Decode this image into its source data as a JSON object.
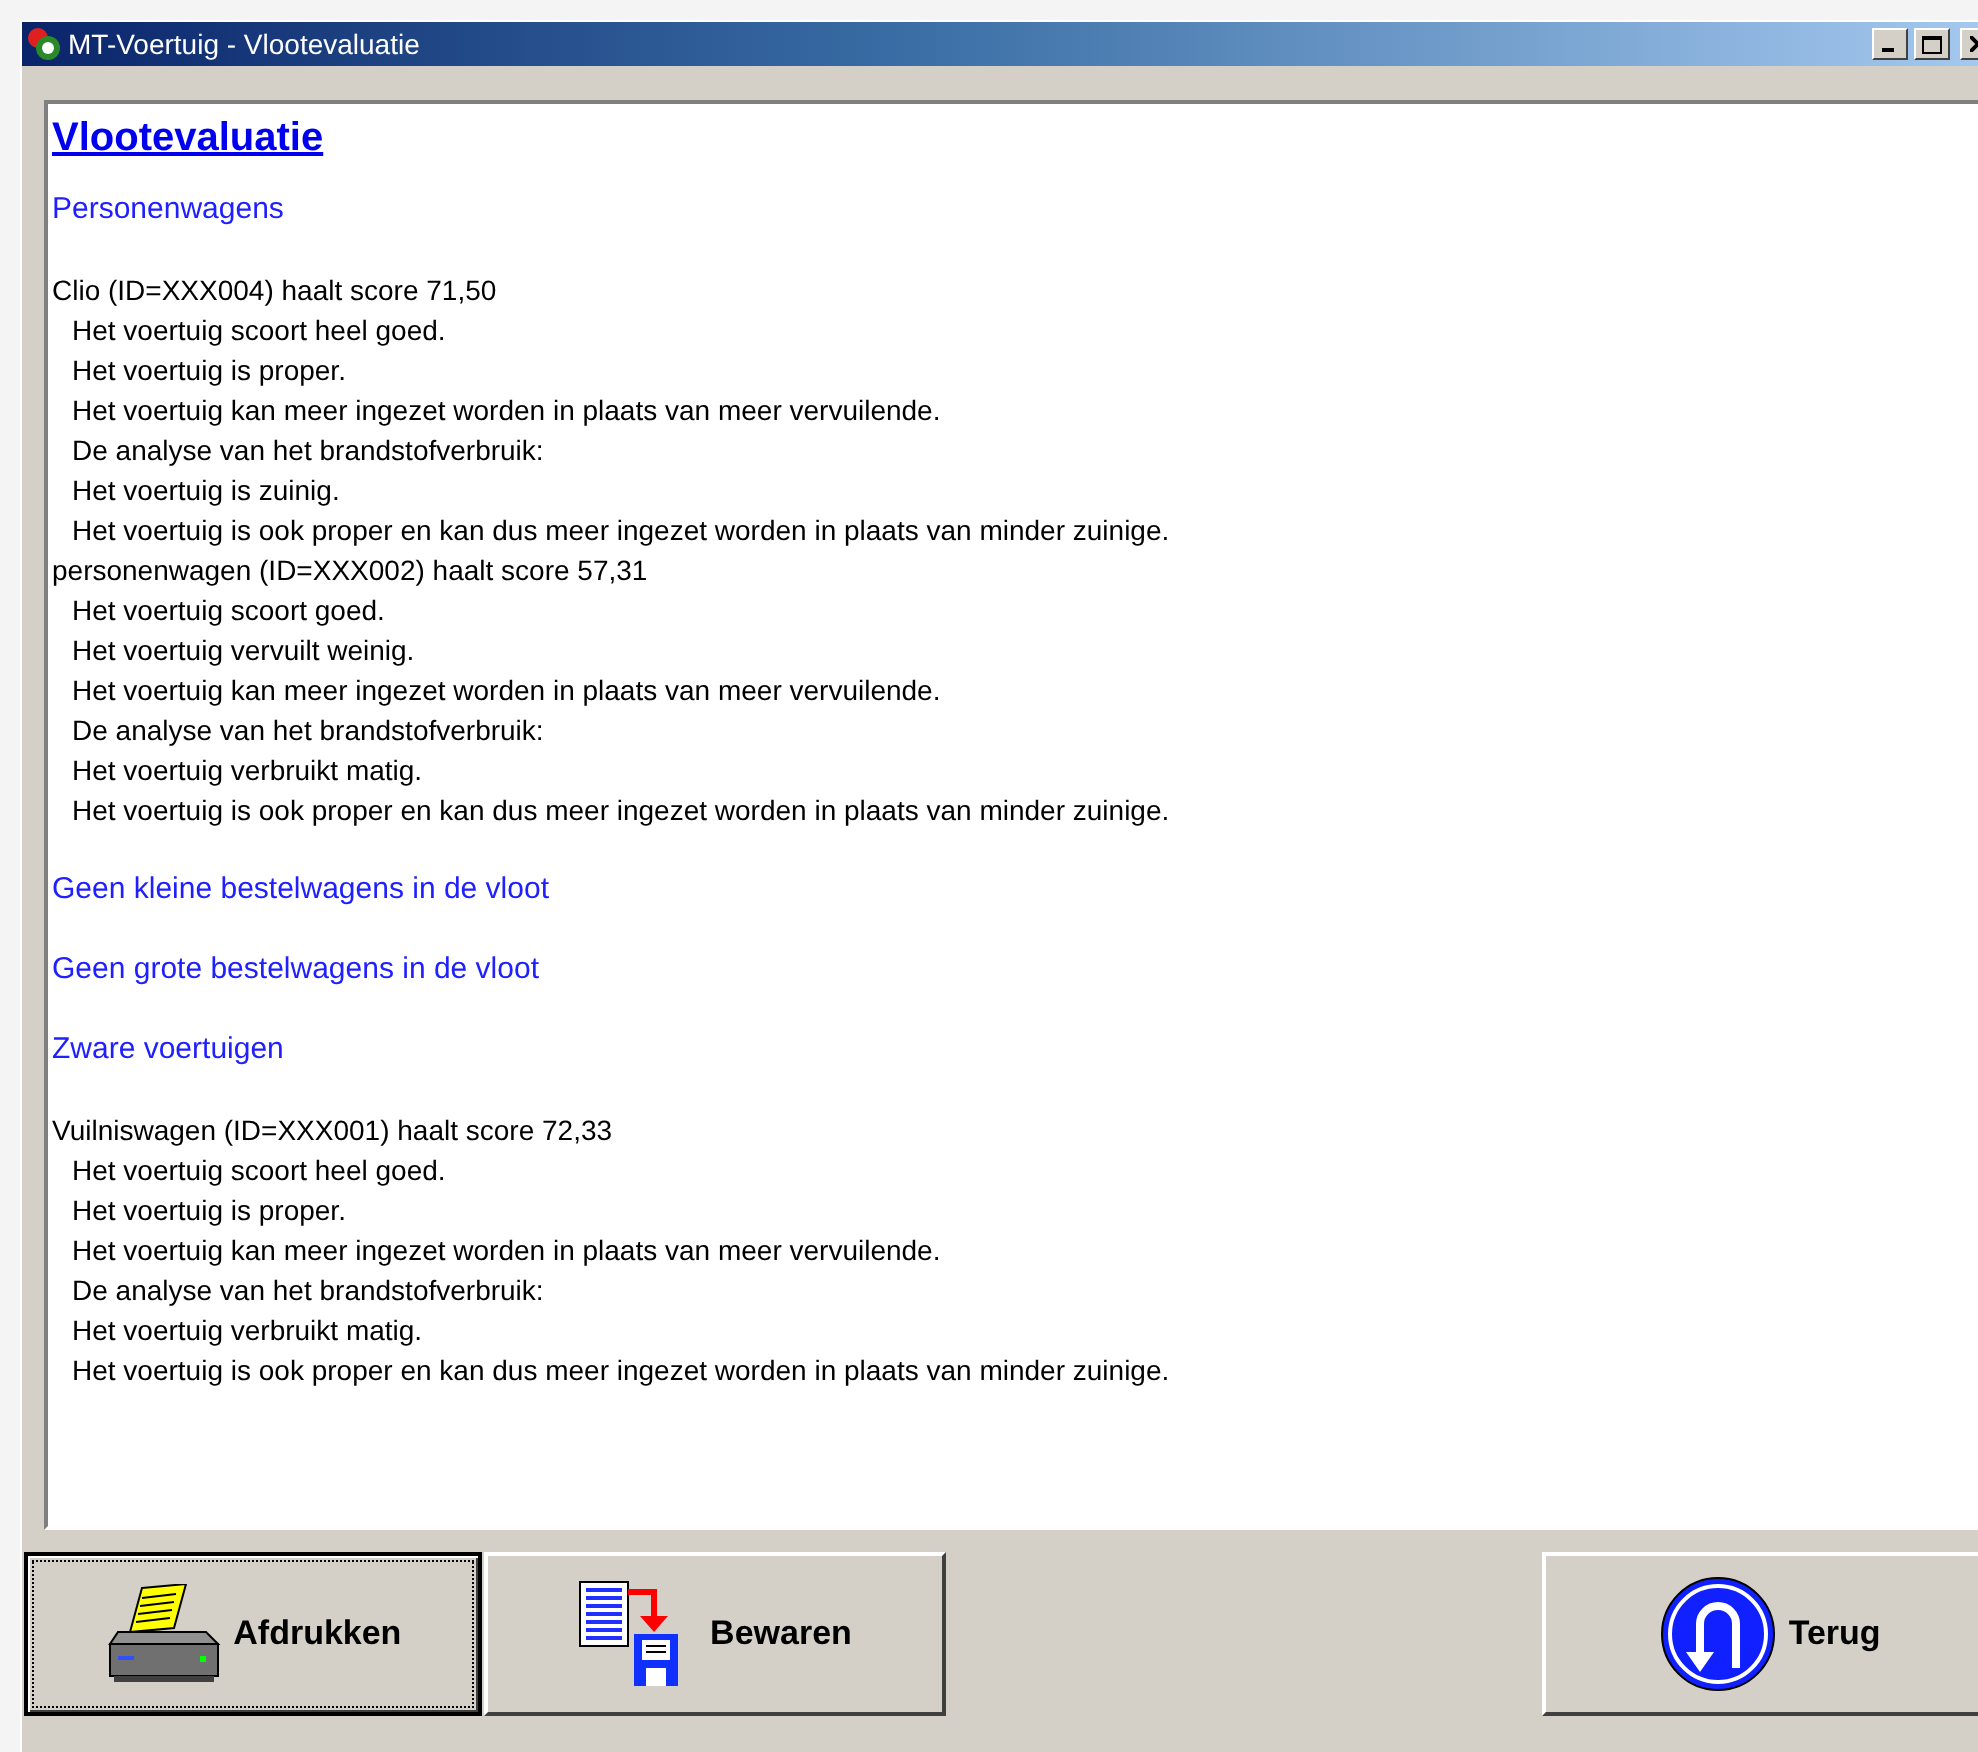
{
  "window": {
    "title": "MT-Voertuig - Vlootevaluatie"
  },
  "report": {
    "heading": "Vlootevaluatie",
    "blocks": [
      {
        "kind": "section",
        "text": "Personenwagens"
      },
      {
        "kind": "vehicle",
        "text": "Clio (ID=XXX004) haalt score 71,50"
      },
      {
        "kind": "detail",
        "text": "Het voertuig scoort heel goed."
      },
      {
        "kind": "detail",
        "text": "Het voertuig is proper."
      },
      {
        "kind": "detail",
        "text": "Het voertuig kan meer ingezet worden in plaats van meer vervuilende."
      },
      {
        "kind": "detail",
        "text": "De analyse van het brandstofverbruik:"
      },
      {
        "kind": "detail",
        "text": "Het voertuig is zuinig."
      },
      {
        "kind": "detail",
        "text": "Het voertuig is ook proper en kan dus meer ingezet worden in plaats van minder zuinige."
      },
      {
        "kind": "vehicle",
        "text": "personenwagen (ID=XXX002) haalt score 57,31"
      },
      {
        "kind": "detail",
        "text": "Het voertuig scoort goed."
      },
      {
        "kind": "detail",
        "text": "Het voertuig vervuilt weinig."
      },
      {
        "kind": "detail",
        "text": "Het voertuig kan meer ingezet worden in plaats van meer vervuilende."
      },
      {
        "kind": "detail",
        "text": "De analyse van het brandstofverbruik:"
      },
      {
        "kind": "detail",
        "text": "Het voertuig verbruikt matig."
      },
      {
        "kind": "detail",
        "text": "Het voertuig is ook proper en kan dus meer ingezet worden in plaats van minder zuinige."
      },
      {
        "kind": "section",
        "text": "Geen kleine bestelwagens in de vloot"
      },
      {
        "kind": "section",
        "text": "Geen grote bestelwagens in de vloot"
      },
      {
        "kind": "section",
        "text": "Zware voertuigen"
      },
      {
        "kind": "vehicle",
        "text": "Vuilniswagen (ID=XXX001) haalt score 72,33"
      },
      {
        "kind": "detail",
        "text": "Het voertuig scoort heel goed."
      },
      {
        "kind": "detail",
        "text": "Het voertuig is proper."
      },
      {
        "kind": "detail",
        "text": "Het voertuig kan meer ingezet worden in plaats van meer vervuilende."
      },
      {
        "kind": "detail",
        "text": "De analyse van het brandstofverbruik:"
      },
      {
        "kind": "detail",
        "text": "Het voertuig verbruikt matig."
      },
      {
        "kind": "detail",
        "text": "Het voertuig is ook proper en kan dus meer ingezet worden in plaats van minder zuinige."
      }
    ]
  },
  "buttons": [
    {
      "kind": "print",
      "label": "Afdrukken",
      "focused": true
    },
    {
      "kind": "save",
      "label": "Bewaren",
      "focused": false
    },
    {
      "kind": "back",
      "label": "Terug",
      "focused": false
    }
  ]
}
